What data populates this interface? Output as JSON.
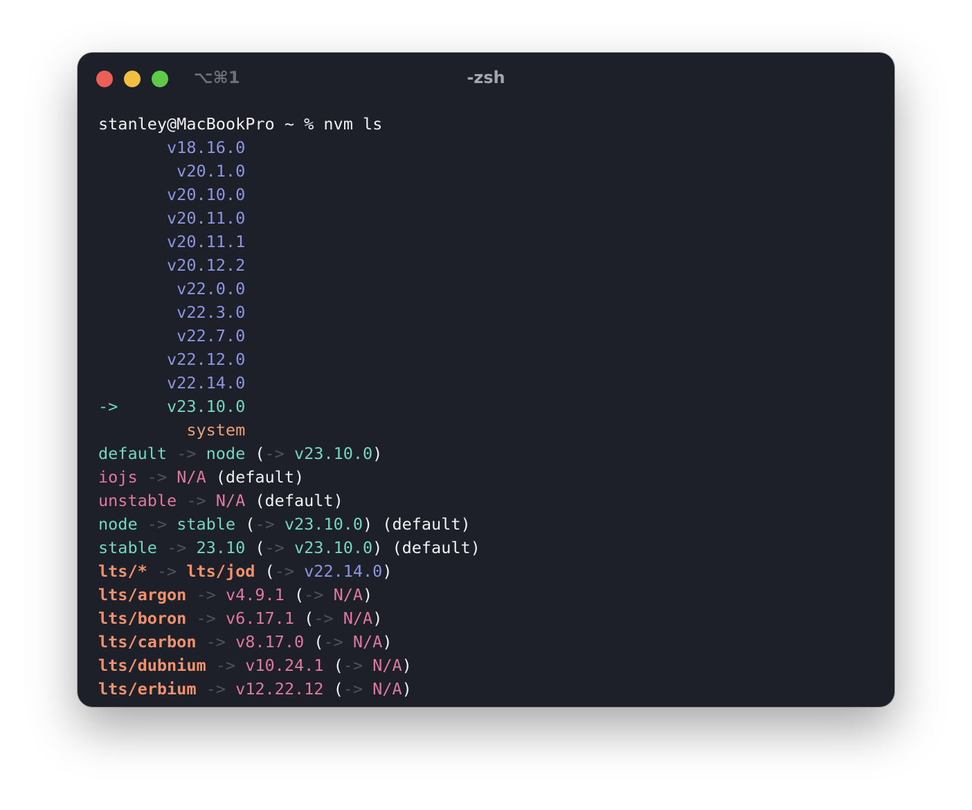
{
  "window": {
    "shortcut": "⌥⌘1",
    "title": "-zsh"
  },
  "colors": {
    "background": "#1e2029",
    "white": "#f0f0f2",
    "blue": "#8e95e0",
    "cyan": "#73d6c3",
    "pink": "#e0789f",
    "orange": "#f0916b",
    "gray": "#4e5160"
  },
  "terminal": {
    "lines": [
      [
        {
          "t": "stanley@MacBookPro ~ % nvm ls",
          "c": "white"
        }
      ],
      [
        {
          "t": "       v18.16.0",
          "c": "blue"
        }
      ],
      [
        {
          "t": "        v20.1.0",
          "c": "blue"
        }
      ],
      [
        {
          "t": "       v20.10.0",
          "c": "blue"
        }
      ],
      [
        {
          "t": "       v20.11.0",
          "c": "blue"
        }
      ],
      [
        {
          "t": "       v20.11.1",
          "c": "blue"
        }
      ],
      [
        {
          "t": "       v20.12.2",
          "c": "blue"
        }
      ],
      [
        {
          "t": "        v22.0.0",
          "c": "blue"
        }
      ],
      [
        {
          "t": "        v22.3.0",
          "c": "blue"
        }
      ],
      [
        {
          "t": "        v22.7.0",
          "c": "blue"
        }
      ],
      [
        {
          "t": "       v22.12.0",
          "c": "blue"
        }
      ],
      [
        {
          "t": "       v22.14.0",
          "c": "blue"
        }
      ],
      [
        {
          "t": "->     v23.10.0",
          "c": "cyan"
        }
      ],
      [
        {
          "t": "         system",
          "c": "system"
        }
      ],
      [
        {
          "t": "default",
          "c": "cyan"
        },
        {
          "t": " -> ",
          "c": "gray"
        },
        {
          "t": "node",
          "c": "cyan"
        },
        {
          "t": " (",
          "c": "white"
        },
        {
          "t": "-> ",
          "c": "gray"
        },
        {
          "t": "v23.10.0",
          "c": "cyan"
        },
        {
          "t": ")",
          "c": "white"
        }
      ],
      [
        {
          "t": "iojs",
          "c": "pink"
        },
        {
          "t": " -> ",
          "c": "gray"
        },
        {
          "t": "N/A",
          "c": "pink"
        },
        {
          "t": " (default)",
          "c": "white"
        }
      ],
      [
        {
          "t": "unstable",
          "c": "pink"
        },
        {
          "t": " -> ",
          "c": "gray"
        },
        {
          "t": "N/A",
          "c": "pink"
        },
        {
          "t": " (default)",
          "c": "white"
        }
      ],
      [
        {
          "t": "node",
          "c": "cyan"
        },
        {
          "t": " -> ",
          "c": "gray"
        },
        {
          "t": "stable",
          "c": "cyan"
        },
        {
          "t": " (",
          "c": "white"
        },
        {
          "t": "-> ",
          "c": "gray"
        },
        {
          "t": "v23.10.0",
          "c": "cyan"
        },
        {
          "t": ") (default)",
          "c": "white"
        }
      ],
      [
        {
          "t": "stable",
          "c": "cyan"
        },
        {
          "t": " -> ",
          "c": "gray"
        },
        {
          "t": "23.10",
          "c": "cyan"
        },
        {
          "t": " (",
          "c": "white"
        },
        {
          "t": "-> ",
          "c": "gray"
        },
        {
          "t": "v23.10.0",
          "c": "cyan"
        },
        {
          "t": ") (default)",
          "c": "white"
        }
      ],
      [
        {
          "t": "lts/*",
          "c": "orange-b"
        },
        {
          "t": " -> ",
          "c": "gray"
        },
        {
          "t": "lts/jod",
          "c": "orange-b"
        },
        {
          "t": " (",
          "c": "white"
        },
        {
          "t": "-> ",
          "c": "gray"
        },
        {
          "t": "v22.14.0",
          "c": "blue"
        },
        {
          "t": ")",
          "c": "white"
        }
      ],
      [
        {
          "t": "lts/argon",
          "c": "orange-b"
        },
        {
          "t": " -> ",
          "c": "gray"
        },
        {
          "t": "v4.9.1",
          "c": "pink"
        },
        {
          "t": " (",
          "c": "white"
        },
        {
          "t": "-> ",
          "c": "gray"
        },
        {
          "t": "N/A",
          "c": "pink"
        },
        {
          "t": ")",
          "c": "white"
        }
      ],
      [
        {
          "t": "lts/boron",
          "c": "orange-b"
        },
        {
          "t": " -> ",
          "c": "gray"
        },
        {
          "t": "v6.17.1",
          "c": "pink"
        },
        {
          "t": " (",
          "c": "white"
        },
        {
          "t": "-> ",
          "c": "gray"
        },
        {
          "t": "N/A",
          "c": "pink"
        },
        {
          "t": ")",
          "c": "white"
        }
      ],
      [
        {
          "t": "lts/carbon",
          "c": "orange-b"
        },
        {
          "t": " -> ",
          "c": "gray"
        },
        {
          "t": "v8.17.0",
          "c": "pink"
        },
        {
          "t": " (",
          "c": "white"
        },
        {
          "t": "-> ",
          "c": "gray"
        },
        {
          "t": "N/A",
          "c": "pink"
        },
        {
          "t": ")",
          "c": "white"
        }
      ],
      [
        {
          "t": "lts/dubnium",
          "c": "orange-b"
        },
        {
          "t": " -> ",
          "c": "gray"
        },
        {
          "t": "v10.24.1",
          "c": "pink"
        },
        {
          "t": " (",
          "c": "white"
        },
        {
          "t": "-> ",
          "c": "gray"
        },
        {
          "t": "N/A",
          "c": "pink"
        },
        {
          "t": ")",
          "c": "white"
        }
      ],
      [
        {
          "t": "lts/erbium",
          "c": "orange-b"
        },
        {
          "t": " -> ",
          "c": "gray"
        },
        {
          "t": "v12.22.12",
          "c": "pink"
        },
        {
          "t": " (",
          "c": "white"
        },
        {
          "t": "-> ",
          "c": "gray"
        },
        {
          "t": "N/A",
          "c": "pink"
        },
        {
          "t": ")",
          "c": "white"
        }
      ]
    ]
  }
}
